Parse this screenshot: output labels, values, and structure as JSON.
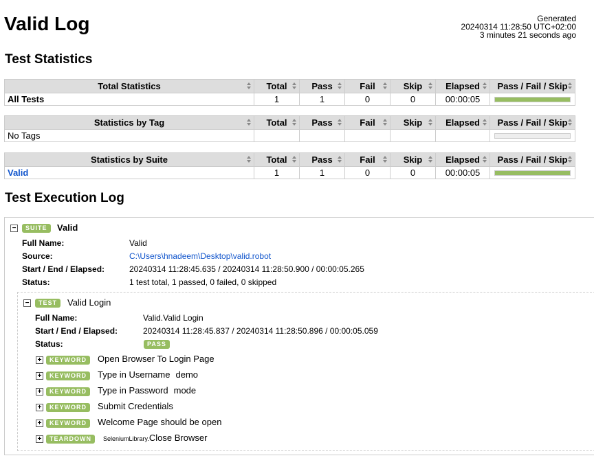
{
  "header": {
    "title": "Valid Log",
    "generated_label": "Generated",
    "generated_time": "20240314 11:28:50 UTC+02:00",
    "generated_ago": "3 minutes 21 seconds ago"
  },
  "stats": {
    "heading": "Test Statistics",
    "columns": [
      "Total",
      "Pass",
      "Fail",
      "Skip",
      "Elapsed",
      "Pass / Fail / Skip"
    ],
    "total": {
      "title": "Total Statistics",
      "name": "All Tests",
      "total": "1",
      "pass": "1",
      "fail": "0",
      "skip": "0",
      "elapsed": "00:00:05",
      "pass_fraction": 1.0
    },
    "tag": {
      "title": "Statistics by Tag",
      "name": "No Tags"
    },
    "suite": {
      "title": "Statistics by Suite",
      "name": "Valid",
      "total": "1",
      "pass": "1",
      "fail": "0",
      "skip": "0",
      "elapsed": "00:00:05",
      "pass_fraction": 1.0
    }
  },
  "log": {
    "heading": "Test Execution Log",
    "suite": {
      "badge": "SUITE",
      "name": "Valid",
      "full_name_label": "Full Name:",
      "full_name": "Valid",
      "source_label": "Source:",
      "source": "C:\\Users\\hnadeem\\Desktop\\valid.robot",
      "times_label": "Start / End / Elapsed:",
      "times": "20240314 11:28:45.635 / 20240314 11:28:50.900 / 00:00:05.265",
      "status_label": "Status:",
      "status": "1 test total, 1 passed, 0 failed, 0 skipped"
    },
    "test": {
      "badge": "TEST",
      "name": "Valid Login",
      "full_name_label": "Full Name:",
      "full_name": "Valid.Valid Login",
      "times_label": "Start / End / Elapsed:",
      "times": "20240314 11:28:45.837 / 20240314 11:28:50.896 / 00:00:05.059",
      "status_label": "Status:",
      "status": "PASS"
    },
    "keywords": [
      {
        "badge": "KEYWORD",
        "name": "Open Browser To Login Page",
        "arg": ""
      },
      {
        "badge": "KEYWORD",
        "name": "Type in Username",
        "arg": "demo"
      },
      {
        "badge": "KEYWORD",
        "name": "Type in Password",
        "arg": "mode"
      },
      {
        "badge": "KEYWORD",
        "name": "Submit Credentials",
        "arg": ""
      },
      {
        "badge": "KEYWORD",
        "name": "Welcome Page should be open",
        "arg": ""
      },
      {
        "badge": "TEARDOWN",
        "prefix": "SeleniumLibrary.",
        "name": "Close Browser",
        "arg": ""
      }
    ]
  },
  "colors": {
    "pass": "#97bd61",
    "link": "#1155cc"
  }
}
